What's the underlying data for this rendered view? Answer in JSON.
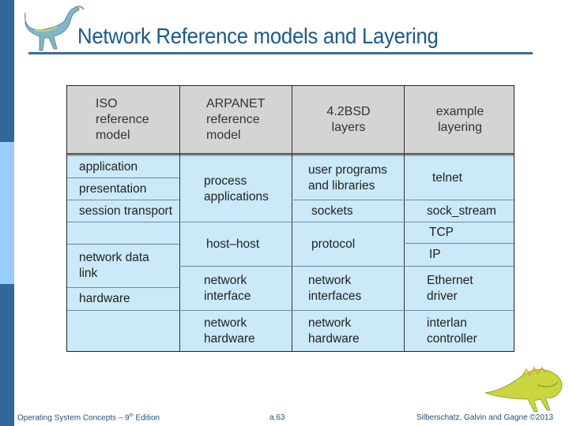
{
  "slide": {
    "title": "Network Reference models and Layering",
    "colors": {
      "sidebar_dark": "#336699",
      "sidebar_light": "#99ccff",
      "title": "#1a5a8a",
      "table_header": "#d4d4d4",
      "table_body": "#cbe9f9"
    }
  },
  "table": {
    "headers": [
      [
        "ISO",
        "reference",
        "model"
      ],
      [
        "ARPANET",
        "reference",
        "model"
      ],
      [
        "4.2BSD",
        "layers"
      ],
      [
        "example",
        "layering"
      ]
    ],
    "iso": [
      "application",
      "presentation",
      "session transport",
      "",
      "network data link",
      "hardware",
      ""
    ],
    "arpanet": [
      "process applications",
      "host–host",
      "network interface",
      "network hardware"
    ],
    "bsd": [
      "user programs and libraries",
      "sockets",
      "protocol",
      "network interfaces",
      "network hardware"
    ],
    "example": [
      "telnet",
      "sock_stream",
      "TCP",
      "IP",
      "Ethernet driver",
      "interlan controller"
    ]
  },
  "footer": {
    "book": "Operating System Concepts – 9",
    "edition_sup": "th",
    "edition_suffix": " Edition",
    "page": "a.63",
    "copyright": "Silberschatz, Galvin and Gagne ©2013"
  },
  "icons": {
    "top_left": "dinosaur-icon",
    "bottom_right": "dinosaur-icon"
  }
}
